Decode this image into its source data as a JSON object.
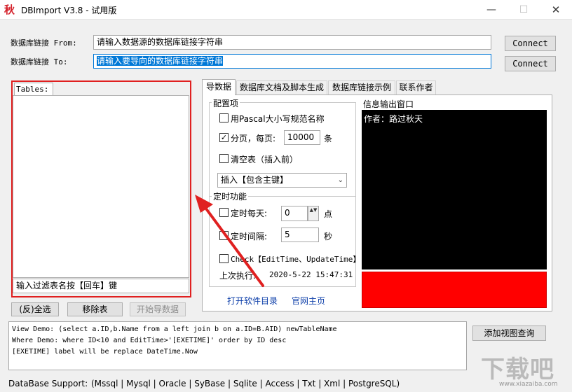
{
  "window": {
    "app_icon_glyph": "秋",
    "title": "DBImport V3.8 - 试用版",
    "minimize_glyph": "—",
    "maximize_glyph": "☐",
    "close_glyph": "✕"
  },
  "connection": {
    "from_label": "数据库链接 From:",
    "from_value": "请输入数据源的数据库链接字符串",
    "to_label": "数据库链接 To:",
    "to_value": "请输入要导向的数据库链接字符串",
    "connect_label": "Connect"
  },
  "tables": {
    "tab_label": "Tables:",
    "filter_placeholder": "输入过滤表名按【回车】键"
  },
  "buttons": {
    "select_all": "(反)全选",
    "remove_table": "移除表",
    "start_import": "开始导数据",
    "add_view": "添加视图查询"
  },
  "tabs": [
    {
      "label": "导数据",
      "active": true
    },
    {
      "label": "数据库文档及脚本生成",
      "active": false
    },
    {
      "label": "数据库链接示例",
      "active": false
    },
    {
      "label": "联系作者",
      "active": false
    }
  ],
  "config": {
    "title": "配置项",
    "pascal_label": "用Pascal大小写规范名称",
    "pascal_checked": false,
    "paging_label": "分页，每页:",
    "paging_checked": true,
    "paging_value": "10000",
    "paging_unit": "条",
    "truncate_label": "清空表（插入前）",
    "truncate_checked": false,
    "insert_mode": "插入【包含主键】",
    "check_glyph": "✓",
    "dropdown_glyph": "⌄"
  },
  "timer": {
    "title": "定时功能",
    "daily_label": "定时每天:",
    "daily_value": "0",
    "daily_unit": "点",
    "interval_label": "定时间隔:",
    "interval_value": "5",
    "interval_unit": "秒",
    "check_label": "Check【EditTime、UpdateTime】",
    "last_run_label": "上次执行:",
    "last_run_value": "2020-5-22 15:47:31",
    "spinner_glyph": "▲▼"
  },
  "links": {
    "open_dir": "打开软件目录",
    "homepage": "官网主页"
  },
  "info": {
    "title": "信息输出窗口",
    "output": "作者：路过秋天"
  },
  "demo": {
    "lines": [
      "View  Demo: (select a.ID,b.Name from a left join b on a.ID=B.AID) newTableName",
      "Where Demo: where ID<10 and EditTime>'[EXETIME]' order by ID desc",
      "[EXETIME] label will be replace DateTime.Now"
    ]
  },
  "support": {
    "label": "DataBase Support:",
    "value": "(Mssql | Mysql | Oracle | SyBase | Sqlite | Access | Txt | Xml | PostgreSQL)"
  },
  "watermark": {
    "text": "下载吧",
    "url": "www.xiazaiba.com"
  },
  "colors": {
    "highlight": "#e02020",
    "status_bar": "#ff0000",
    "console_bg": "#000000",
    "selection": "#0078d7"
  }
}
